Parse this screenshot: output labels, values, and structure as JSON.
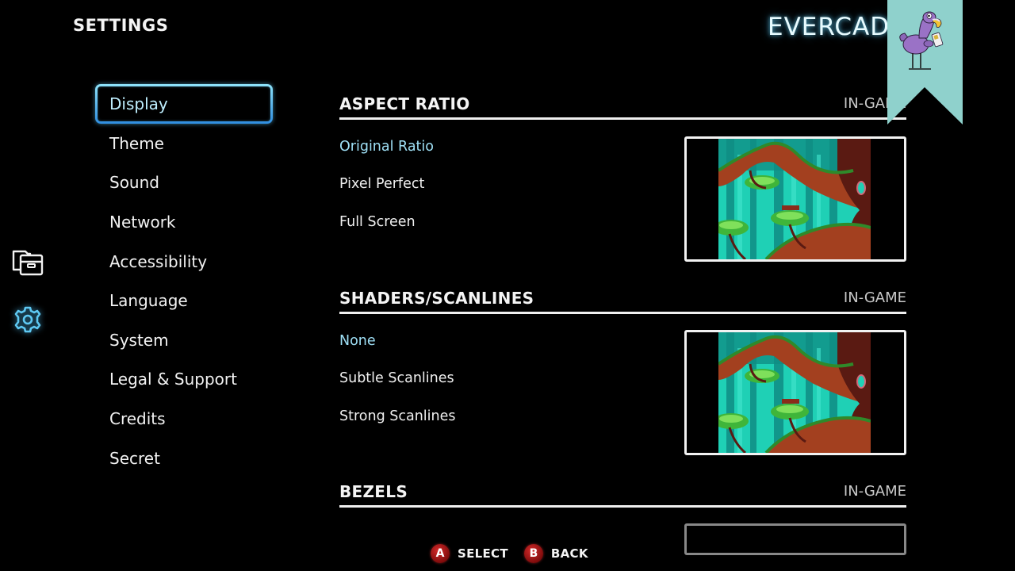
{
  "header": {
    "title": "SETTINGS",
    "brand": "EVERCADE"
  },
  "rail": {
    "items": [
      {
        "icon": "library-icon",
        "active": false
      },
      {
        "icon": "gear-icon",
        "active": true
      }
    ]
  },
  "menu": {
    "selected_index": 0,
    "items": [
      {
        "label": "Display"
      },
      {
        "label": "Theme"
      },
      {
        "label": "Sound"
      },
      {
        "label": "Network"
      },
      {
        "label": "Accessibility"
      },
      {
        "label": "Language"
      },
      {
        "label": "System"
      },
      {
        "label": "Legal & Support"
      },
      {
        "label": "Credits"
      },
      {
        "label": "Secret"
      }
    ]
  },
  "sections": [
    {
      "title": "ASPECT RATIO",
      "tag": "IN-GAME",
      "selected_option": 0,
      "options": [
        "Original Ratio",
        "Pixel Perfect",
        "Full Screen"
      ]
    },
    {
      "title": "SHADERS/SCANLINES",
      "tag": "IN-GAME",
      "selected_option": 0,
      "options": [
        "None",
        "Subtle Scanlines",
        "Strong Scanlines"
      ]
    },
    {
      "title": "BEZELS",
      "tag": "IN-GAME",
      "options": []
    }
  ],
  "footer": {
    "hints": [
      {
        "button": "A",
        "label": "SELECT"
      },
      {
        "button": "B",
        "label": "BACK"
      }
    ]
  },
  "colors": {
    "background": "#000000",
    "accent": "#5fc4f0",
    "selected_text": "#9fe0f6",
    "ribbon": "#8fd1cc",
    "button_red": "#b31d1d"
  }
}
